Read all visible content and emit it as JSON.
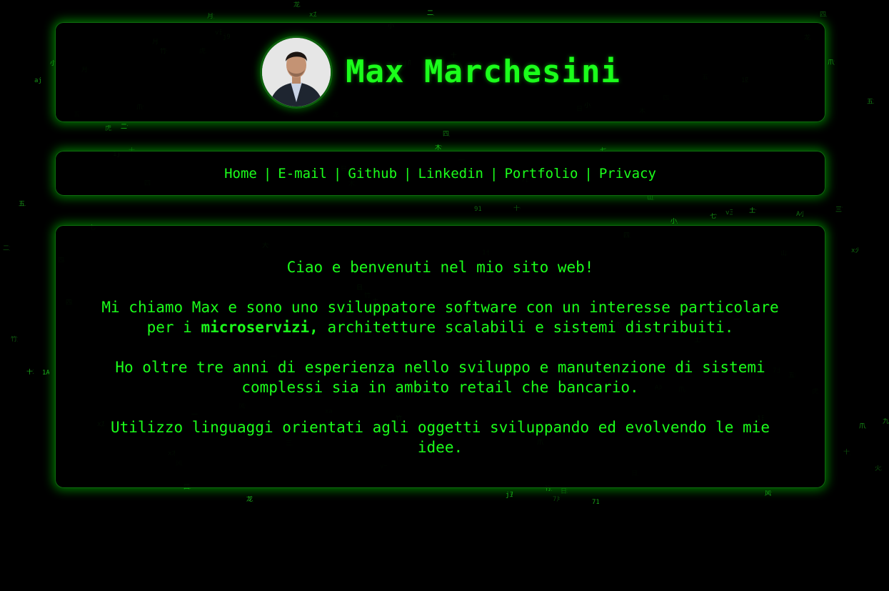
{
  "header": {
    "title": "Max Marchesini",
    "avatar_alt": "Max Marchesini"
  },
  "nav": {
    "items": [
      {
        "label": "Home"
      },
      {
        "label": "E-mail"
      },
      {
        "label": "Github"
      },
      {
        "label": "Linkedin"
      },
      {
        "label": "Portfolio"
      },
      {
        "label": "Privacy"
      }
    ],
    "separator": "|"
  },
  "main": {
    "greeting": "Ciao e benvenuti nel mio sito web!",
    "intro_before": "Mi chiamo Max e sono uno sviluppatore software con un interesse particolare per i ",
    "intro_bold": "microservizi,",
    "intro_after": " architetture scalabili e sistemi distribuiti.",
    "experience": "Ho oltre tre anni di esperienza nello sviluppo e manutenzione di sistemi complessi sia in ambito retail che bancario.",
    "languages": "Utilizzo linguaggi orientati agli oggetti sviluppando ed evolvendo le mie idee."
  },
  "theme": {
    "accent": "#1bff1b",
    "rain": "#1fc21f",
    "background": "#000000"
  }
}
